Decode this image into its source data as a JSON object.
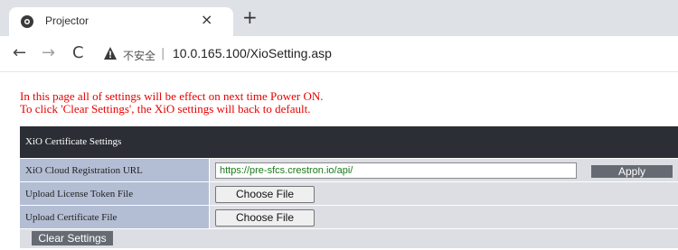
{
  "browser": {
    "tab": {
      "title": "Projector",
      "close_glyph": "×",
      "favicon": "settings-gear-icon"
    },
    "new_tab_glyph": "+",
    "nav": {
      "back_glyph": "←",
      "forward_glyph": "→",
      "reload_glyph": "C"
    },
    "address": {
      "security_icon": "warning-triangle-icon",
      "security_label": "不安全",
      "separator": "|",
      "url": "10.0.165.100/XioSetting.asp"
    }
  },
  "page": {
    "notice_line1": "In this page all of settings will be effect on next time Power ON.",
    "notice_line2": "To click 'Clear Settings', the XiO settings will back to default.",
    "notice_color": "#e60000",
    "panel": {
      "title": "XiO Certificate Settings",
      "rows": [
        {
          "label": "XiO Cloud Registration URL",
          "input_value": "https://pre-sfcs.crestron.io/api/",
          "button_label": "Apply"
        },
        {
          "label": "Upload License Token File",
          "button_label": "Choose File"
        },
        {
          "label": "Upload Certificate File",
          "button_label": "Choose File"
        }
      ]
    },
    "clear_button_label": "Clear Settings"
  },
  "colors": {
    "header_bg": "#2b2f35",
    "label_bg": "#b3bdd3",
    "row_bg": "#dcdee3",
    "button_bg": "#666b73",
    "url_text": "#1a7a1a"
  }
}
